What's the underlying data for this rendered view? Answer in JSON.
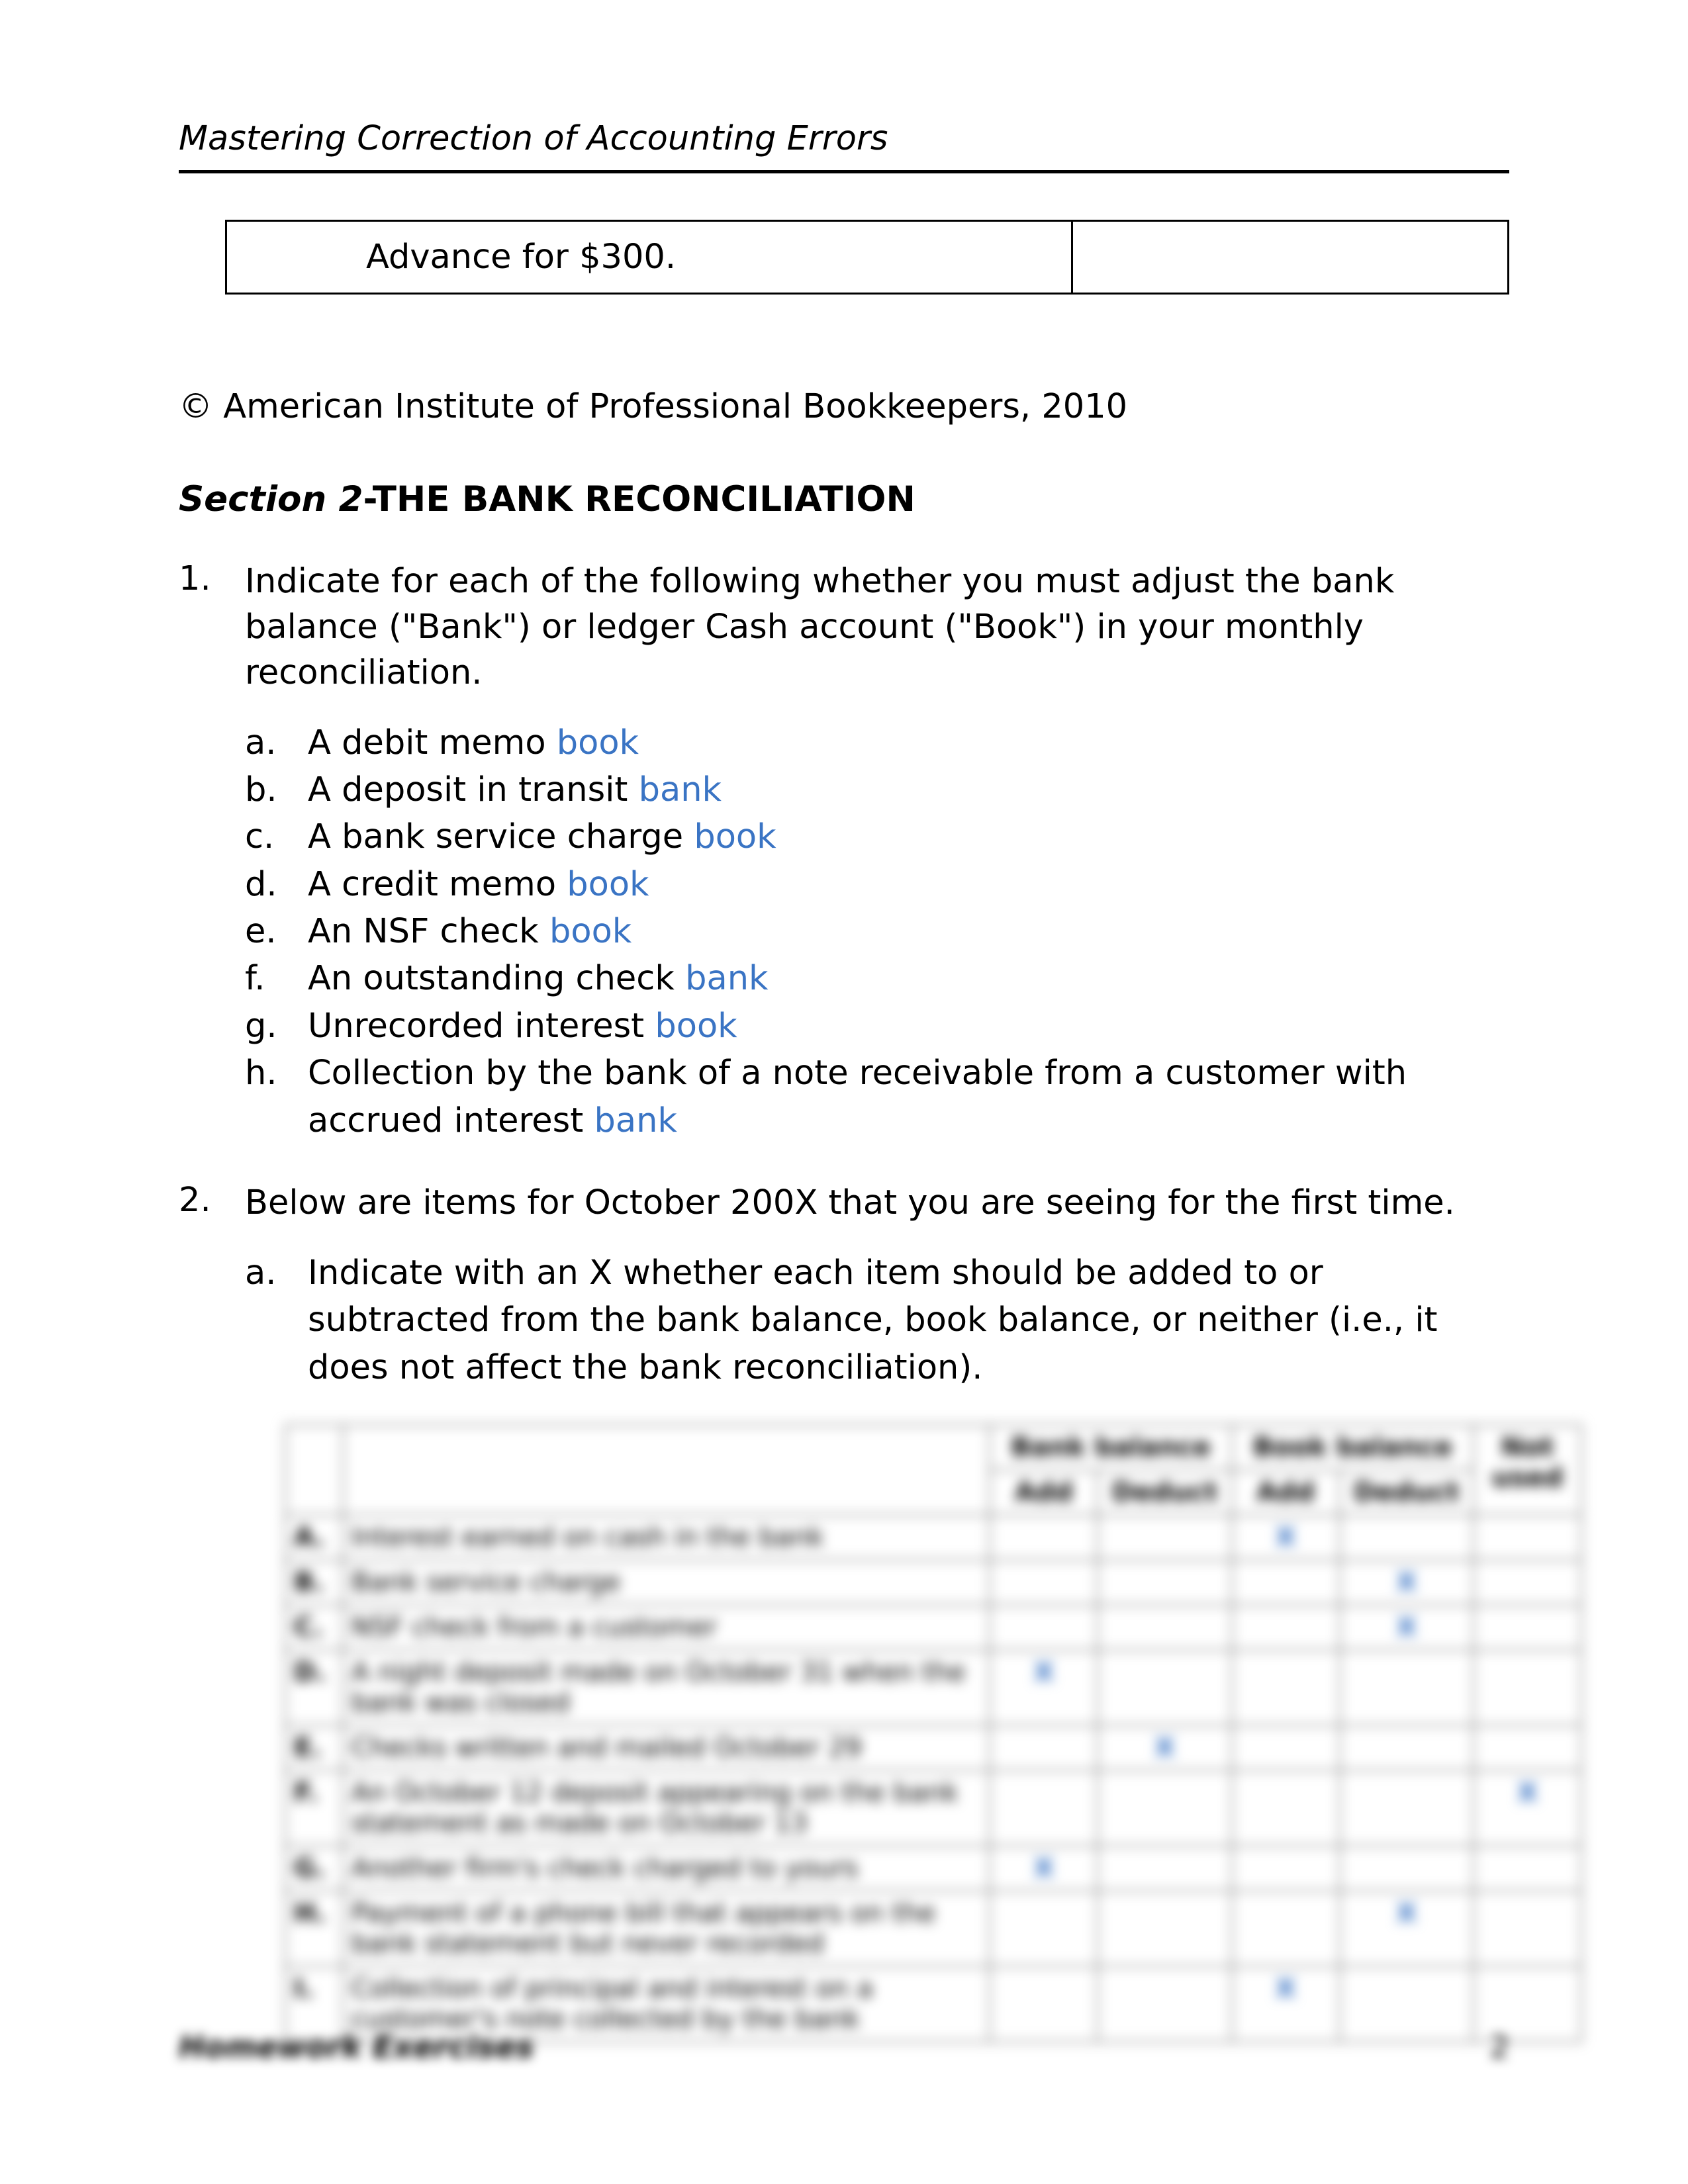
{
  "header": {
    "running_title": "Mastering Correction of Accounting Errors"
  },
  "advance_box": {
    "left": "Advance for $300.",
    "right": ""
  },
  "copyright": "© American Institute of Professional Bookkeepers, 2010",
  "section": {
    "lead": "Section 2",
    "title": "-THE BANK RECONCILIATION"
  },
  "q1": {
    "number": "1.",
    "text": "Indicate for each of the following whether you must adjust the bank balance (\"Bank\") or ledger Cash account (\"Book\") in your monthly reconciliation.",
    "items": [
      {
        "letter": "a.",
        "text": "A debit memo ",
        "answer": "book"
      },
      {
        "letter": "b.",
        "text": "A deposit in transit ",
        "answer": "bank"
      },
      {
        "letter": "c.",
        "text": "A bank service charge ",
        "answer": "book"
      },
      {
        "letter": "d.",
        "text": "A credit memo ",
        "answer": "book"
      },
      {
        "letter": "e.",
        "text": "An NSF check ",
        "answer": "book"
      },
      {
        "letter": "f.",
        "text": "An outstanding check ",
        "answer": "bank"
      },
      {
        "letter": "g.",
        "text": "Unrecorded interest ",
        "answer": "book"
      },
      {
        "letter": "h.",
        "text": "Collection by the bank of a note receivable from a customer with accrued interest ",
        "answer": "bank"
      }
    ]
  },
  "q2": {
    "number": "2.",
    "text": "Below are items for October 200X that you are seeing for the first time.",
    "sub": {
      "letter": "a.",
      "text": "Indicate with an X whether each item should be added to or subtracted from the bank balance, book balance, or neither (i.e., it does not affect the bank reconciliation)."
    }
  },
  "table": {
    "head": {
      "bank_group": "Bank balance",
      "book_group": "Book balance",
      "not_used": "Not used",
      "add": "Add",
      "deduct": "Deduct"
    },
    "rows": [
      {
        "label": "A.",
        "desc": "Interest earned on cash in the bank",
        "bank_add": "",
        "bank_ded": "",
        "book_add": "X",
        "book_ded": "",
        "not": ""
      },
      {
        "label": "B.",
        "desc": "Bank service charge",
        "bank_add": "",
        "bank_ded": "",
        "book_add": "",
        "book_ded": "X",
        "not": ""
      },
      {
        "label": "C.",
        "desc": "NSF check from a customer",
        "bank_add": "",
        "bank_ded": "",
        "book_add": "",
        "book_ded": "X",
        "not": ""
      },
      {
        "label": "D.",
        "desc": "A night deposit made on October 31 when the bank was closed",
        "bank_add": "X",
        "bank_ded": "",
        "book_add": "",
        "book_ded": "",
        "not": ""
      },
      {
        "label": "E.",
        "desc": "Checks written and mailed October 29",
        "bank_add": "",
        "bank_ded": "X",
        "book_add": "",
        "book_ded": "",
        "not": ""
      },
      {
        "label": "F.",
        "desc": "An October 12 deposit appearing on the bank statement as made on October 13",
        "bank_add": "",
        "bank_ded": "",
        "book_add": "",
        "book_ded": "",
        "not": "X"
      },
      {
        "label": "G.",
        "desc": "Another firm's check charged to yours",
        "bank_add": "X",
        "bank_ded": "",
        "book_add": "",
        "book_ded": "",
        "not": ""
      },
      {
        "label": "H.",
        "desc": "Payment of a phone bill that appears on the bank statement but never recorded",
        "bank_add": "",
        "bank_ded": "",
        "book_add": "",
        "book_ded": "X",
        "not": ""
      },
      {
        "label": "I.",
        "desc": "Collection of principal and interest on a customer's note collected by the bank",
        "bank_add": "",
        "bank_ded": "",
        "book_add": "X",
        "book_ded": "",
        "not": ""
      }
    ]
  },
  "footer": {
    "left": "Homework Exercises",
    "right": "2"
  }
}
